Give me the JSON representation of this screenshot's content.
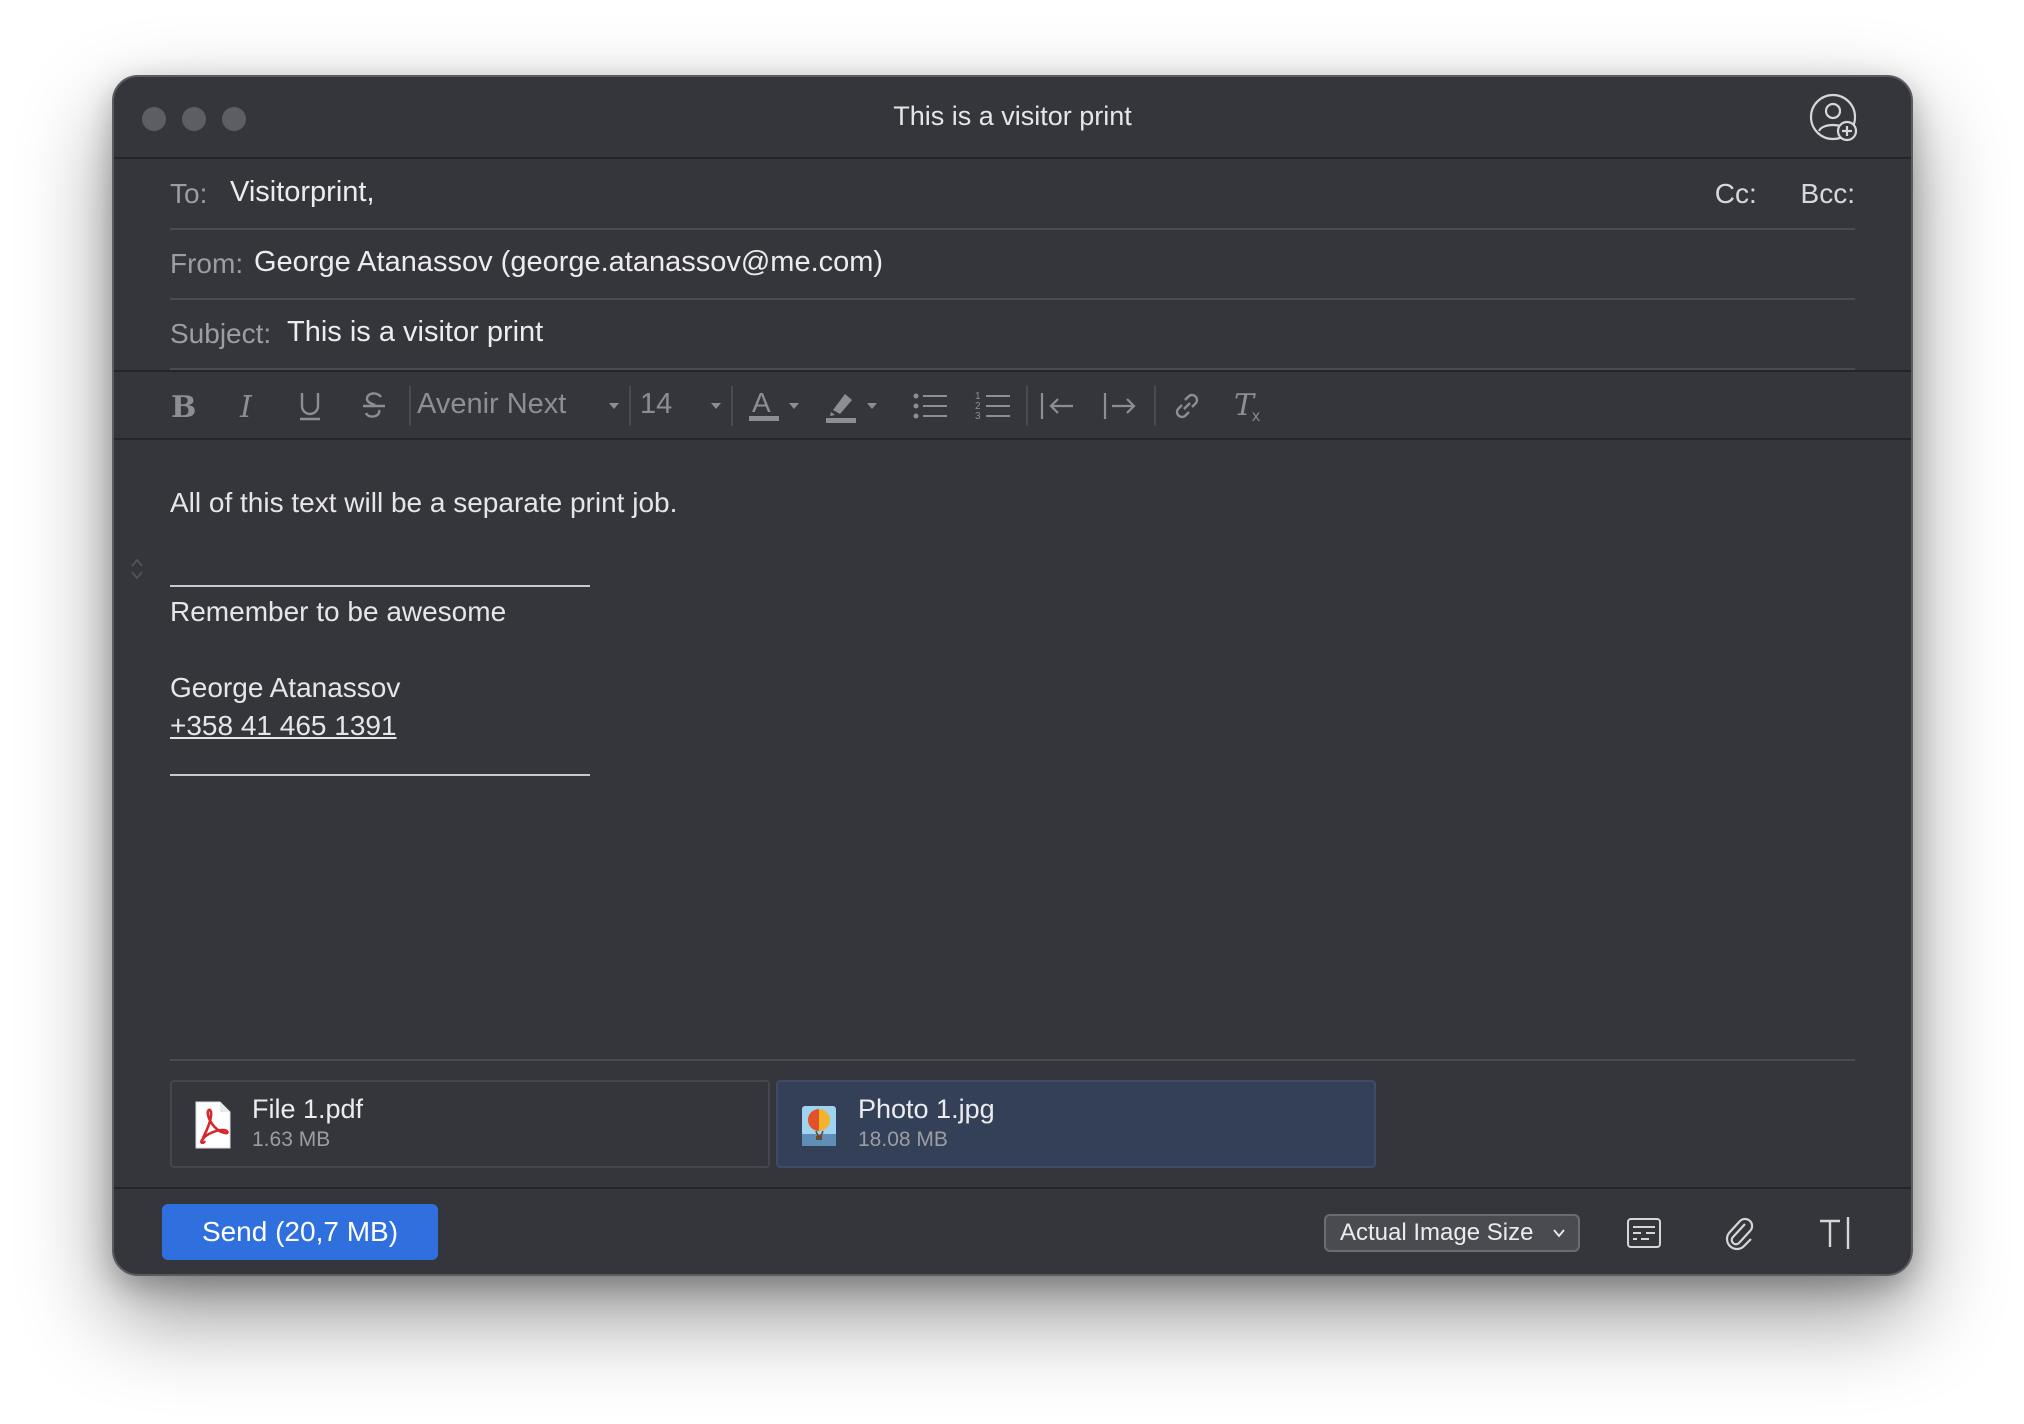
{
  "window": {
    "title": "This is a visitor print"
  },
  "header": {
    "to_label": "To:",
    "to_value": "Visitorprint,",
    "cc_label": "Cc:",
    "bcc_label": "Bcc:",
    "from_label": "From:",
    "from_value": "George Atanassov (george.atanassov@me.com)",
    "subject_label": "Subject:",
    "subject_value": "This is a visitor print"
  },
  "format_bar": {
    "font_name": "Avenir Next",
    "font_size": "14"
  },
  "body": {
    "line1": "All of this text will be a separate print job.",
    "signature_tagline": "Remember to be awesome",
    "signature_name": "George Atanassov",
    "signature_phone": "+358 41 465 1391"
  },
  "attachments": [
    {
      "name": "File 1.pdf",
      "size": "1.63 MB",
      "icon": "pdf-file-icon"
    },
    {
      "name": "Photo 1.jpg",
      "size": "18.08 MB",
      "icon": "image-file-icon"
    }
  ],
  "footer": {
    "send_label": "Send (20,7 MB)",
    "image_size_option": "Actual Image Size"
  },
  "colors": {
    "window_bg": "#35363b",
    "send_blue": "#2f6fde",
    "selected_attachment": "#334058"
  }
}
